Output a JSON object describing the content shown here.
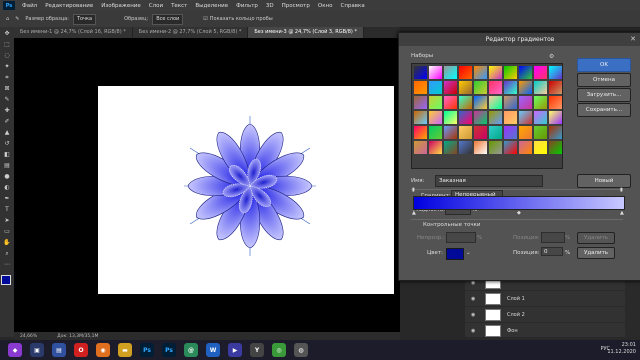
{
  "menu": {
    "app_icon": "Ps",
    "items": [
      "Файл",
      "Редактирование",
      "Изображение",
      "Слои",
      "Текст",
      "Выделение",
      "Фильтр",
      "3D",
      "Просмотр",
      "Окно",
      "Справка"
    ]
  },
  "options_bar": {
    "sample_size_label": "Размер образца:",
    "sample_size_value": "Точка",
    "sample_label": "Образец:",
    "sample_value": "Все слои",
    "show_ring_label": "Показать кольцо пробы"
  },
  "tabs": [
    "Без имени-1 @ 24,7% (Слой 16, RGB/8) *",
    "Без имени-2 @ 27,7% (Слой 5, RGB/8) *",
    "Без имени-3 @ 24,7% (Слой 3, RGB/8) *"
  ],
  "status": {
    "zoom": "24,66%",
    "doc": "Док: 13,3М/35,1М"
  },
  "gradient_editor": {
    "title": "Редактор градиентов",
    "presets_label": "Наборы",
    "buttons": {
      "ok": "OK",
      "cancel": "Отмена",
      "load": "Загрузить...",
      "save": "Сохранить...",
      "new": "Новый"
    },
    "name_label": "Имя:",
    "name_value": "Заказная",
    "type_label": "Градиент:",
    "type_value": "Непрерывный",
    "smooth_label": "Гладкость:",
    "smooth_value": "100",
    "percent": "%",
    "stops_title": "Контрольные точки",
    "opacity_label": "Непрозр.:",
    "position_label": "Позиция:",
    "delete_label": "Удалить",
    "color_label": "Цвет:",
    "color_position_value": "0",
    "stop_color": "#000a99",
    "gradient_start_color": "#0000e0",
    "gradient_end_color": "#c8c8ff"
  },
  "layers": [
    {
      "name": ""
    },
    {
      "name": "Слой 1"
    },
    {
      "name": "Слой 2"
    },
    {
      "name": "Фон"
    }
  ],
  "taskbar": {
    "time": "23:01",
    "date": "11.12.2020",
    "lang": "РУС"
  },
  "preset_colors": [
    "#333333",
    "#ffffff",
    "#999999",
    "#ff0000",
    "#ff8800",
    "#ffff00",
    "#00cc00",
    "#0000ff",
    "#ff00ff",
    "#00ffff",
    "#ff6600",
    "#3399ff",
    "#cc33cc",
    "#ffcc00",
    "#33cc33",
    "#ff3366",
    "#6633cc",
    "#ff9900",
    "#00cccc",
    "#cc0000",
    "#996633",
    "#cccc33",
    "#ff66cc",
    "#33ffcc",
    "#0066ff",
    "#ffcc99",
    "#cc9966",
    "#9966ff",
    "#66ff66",
    "#ff3300",
    "#cc6600",
    "#ffcc33",
    "#00ff99",
    "#3366cc",
    "#cc3399",
    "#999900",
    "#ff9966",
    "#66ccff",
    "#cc66ff",
    "#ffff66",
    "#ff0066",
    "#00cc66",
    "#6699ff",
    "#ffcc66",
    "#cc3333",
    "#33cccc",
    "#9933ff",
    "#ffaa00",
    "#66cc33",
    "#aa3300",
    "#cc9933",
    "#cc0066",
    "#00aa88",
    "#5577cc",
    "#ee7733",
    "#669900",
    "#3399cc",
    "#cc6699",
    "#ffdd44",
    "#884422"
  ]
}
